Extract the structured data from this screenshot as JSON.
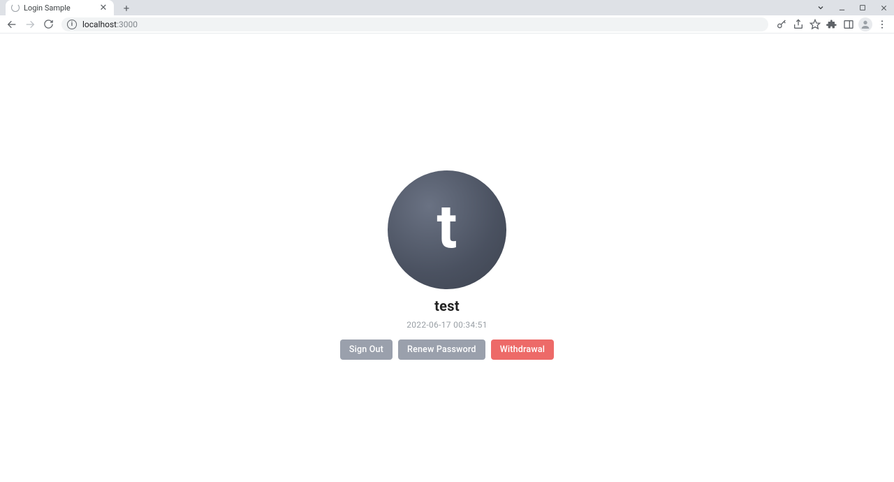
{
  "browser": {
    "tab_title": "Login Sample",
    "url_host": "localhost",
    "url_path": ":3000"
  },
  "profile": {
    "avatar_initial": "t",
    "username": "test",
    "timestamp": "2022-06-17 00:34:51",
    "buttons": {
      "sign_out": "Sign Out",
      "renew_password": "Renew Password",
      "withdrawal": "Withdrawal"
    }
  }
}
